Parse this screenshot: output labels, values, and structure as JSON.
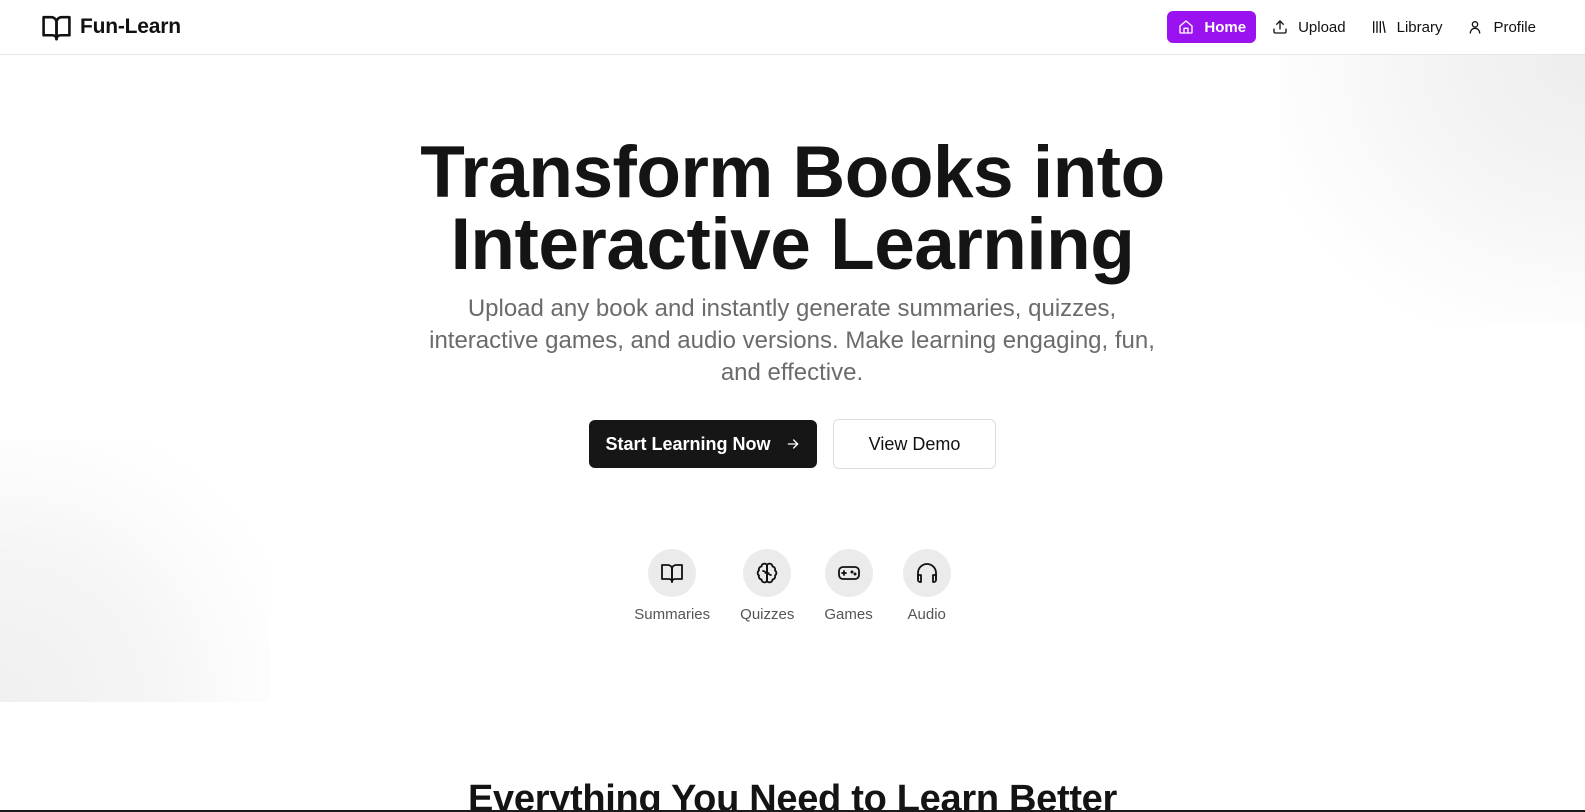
{
  "brand": {
    "name": "Fun-Learn",
    "icon": "open-book-icon"
  },
  "nav": {
    "items": [
      {
        "label": "Home",
        "icon": "home-icon",
        "active": true
      },
      {
        "label": "Upload",
        "icon": "upload-icon",
        "active": false
      },
      {
        "label": "Library",
        "icon": "library-icon",
        "active": false
      },
      {
        "label": "Profile",
        "icon": "user-icon",
        "active": false
      }
    ]
  },
  "hero": {
    "title_line1": "Transform Books into",
    "title_line2": "Interactive Learning",
    "subtitle": "Upload any book and instantly generate summaries, quizzes, interactive games, and audio versions. Make learning engaging, fun, and effective.",
    "primary_cta": "Start Learning Now",
    "secondary_cta": "View Demo"
  },
  "features": [
    {
      "label": "Summaries",
      "icon": "book-open-icon"
    },
    {
      "label": "Quizzes",
      "icon": "brain-icon"
    },
    {
      "label": "Games",
      "icon": "gamepad-icon"
    },
    {
      "label": "Audio",
      "icon": "headphones-icon"
    }
  ],
  "next_section": {
    "heading": "Everything You Need to Learn Better"
  },
  "colors": {
    "accent": "#9b12f0",
    "primary_button": "#161616",
    "muted_text": "#6b6b6b"
  }
}
